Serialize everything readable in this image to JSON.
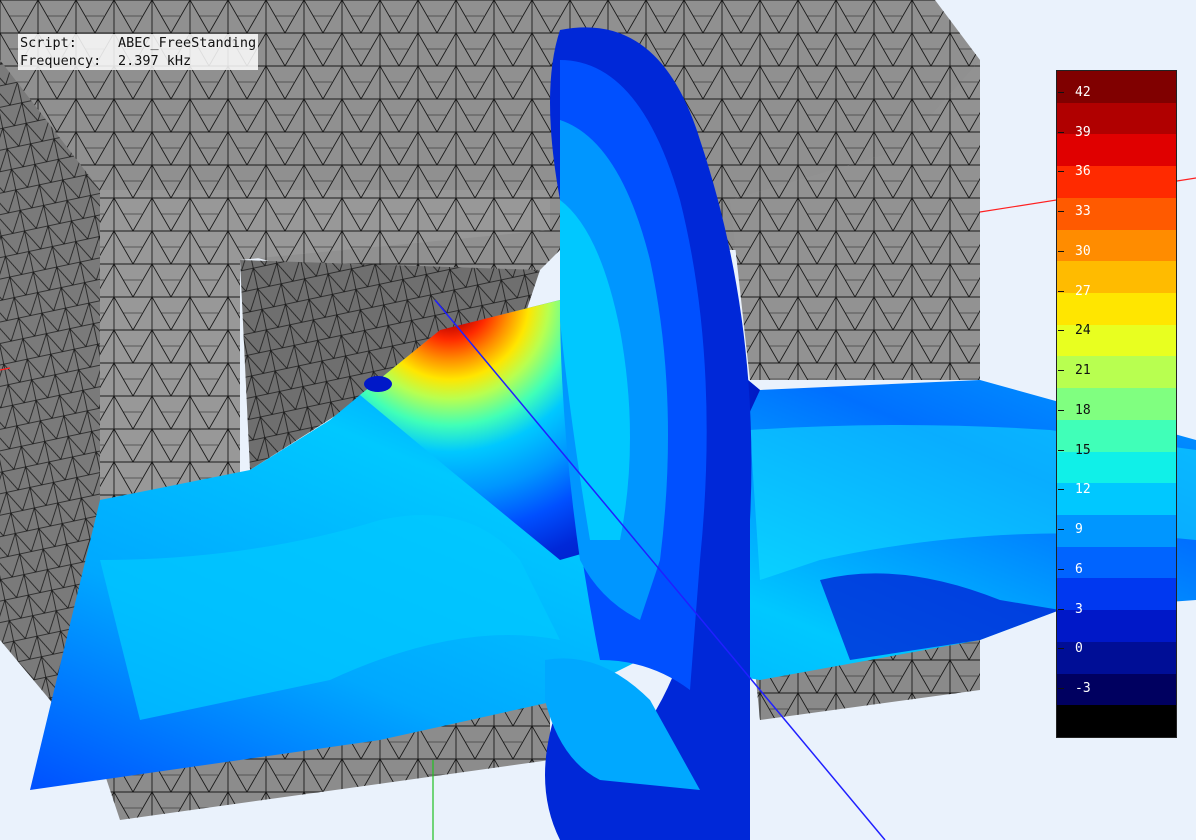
{
  "overlay": {
    "script_label": "Script:",
    "script_value": "ABEC_FreeStanding",
    "frequency_label": "Frequency:",
    "frequency_value": "2.397 kHz"
  },
  "legend": {
    "ticks": [
      "42",
      "39",
      "36",
      "33",
      "30",
      "27",
      "24",
      "21",
      "18",
      "15",
      "12",
      "9",
      "6",
      "3",
      "0",
      "-3"
    ],
    "bands": [
      "#800000",
      "#b00000",
      "#e00000",
      "#ff2a00",
      "#ff5a00",
      "#ff8c00",
      "#ffbb00",
      "#ffe600",
      "#e8ff20",
      "#b8ff50",
      "#80ff80",
      "#40ffb8",
      "#10f0e8",
      "#00c8ff",
      "#0096ff",
      "#0064ff",
      "#0038f0",
      "#0018c8",
      "#000e96",
      "#000060",
      "#000000"
    ]
  },
  "colors": {
    "background": "#eaf2fc",
    "mesh_face": "#8a8a8a",
    "mesh_face_light": "#a0a0a0",
    "mesh_lines": "#1a1a1a",
    "axis_x": "#ff2020",
    "axis_y": "#20c020",
    "axis_z": "#2020ff"
  }
}
